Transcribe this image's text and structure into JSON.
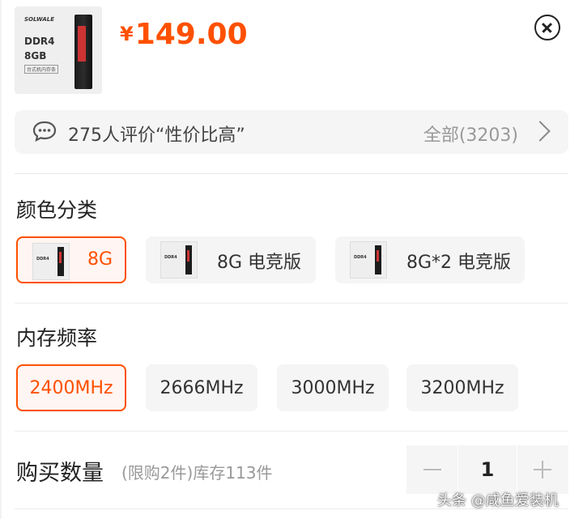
{
  "product": {
    "thumb_brand": "SOLWALE",
    "thumb_line1": "DDR4",
    "thumb_line2": "8GB",
    "thumb_line3": "台式机内存条",
    "currency": "¥",
    "price": "149.00"
  },
  "review": {
    "text": "275人评价“性价比高”",
    "all_label": "全部(3203)"
  },
  "color_section": {
    "title": "颜色分类",
    "options": [
      {
        "label": "8G",
        "selected": true,
        "mini_text": "DDR4"
      },
      {
        "label": "8G 电竞版",
        "selected": false,
        "mini_text": "DDR4"
      },
      {
        "label": "8G*2 电竞版",
        "selected": false,
        "mini_text": "DDR4"
      }
    ]
  },
  "freq_section": {
    "title": "内存频率",
    "options": [
      {
        "label": "2400MHz",
        "selected": true
      },
      {
        "label": "2666MHz",
        "selected": false
      },
      {
        "label": "3000MHz",
        "selected": false
      },
      {
        "label": "3200MHz",
        "selected": false
      }
    ]
  },
  "quantity": {
    "label": "购买数量",
    "note": "(限购2件)库存113件",
    "value": "1"
  },
  "watermark": "头条 @咸鱼爱装机",
  "colors": {
    "accent": "#ff5000",
    "chip_bg": "#f5f5f5",
    "selected_bg": "#fff5f2"
  }
}
